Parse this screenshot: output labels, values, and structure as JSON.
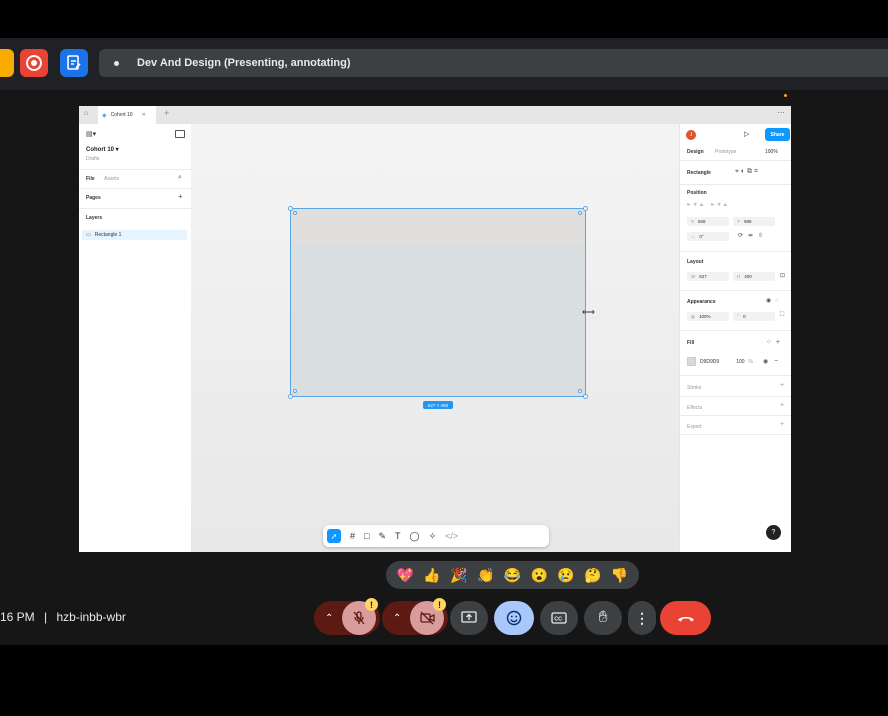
{
  "meet": {
    "presenting_title": "Dev And Design (Presenting, annotating)",
    "time": "16 PM",
    "separator": "|",
    "meeting_code": "hzb-inbb-wbr",
    "reactions": [
      "💖",
      "👍",
      "🎉",
      "👏",
      "😂",
      "😮",
      "😢",
      "🤔",
      "👎"
    ]
  },
  "figma": {
    "tab_title": "Cohort 10",
    "file_name": "Cohort 10",
    "file_location": "Drafts",
    "left_tabs": [
      "File",
      "Assets"
    ],
    "pages_label": "Pages",
    "layers_label": "Layers",
    "layer_name": "Rectangle 1",
    "avatar_initial": "J",
    "share_label": "Share",
    "design_tabs": [
      "Design",
      "Prototype"
    ],
    "zoom": "100%",
    "selection_type": "Rectangle",
    "position_label": "Position",
    "x_label": "X",
    "x_value": "658",
    "y_label": "Y",
    "y_value": "988",
    "rotation_value": "0°",
    "layout_label": "Layout",
    "w_label": "W",
    "w_value": "627",
    "h_label": "H",
    "h_value": "400",
    "appearance_label": "Appearance",
    "opacity_value": "100%",
    "radius_value": "0",
    "fill_label": "Fill",
    "fill_hex": "D9D9D9",
    "fill_opacity": "100",
    "fill_pct": "%",
    "stroke_label": "Stroke",
    "effects_label": "Effects",
    "export_label": "Export",
    "size_badge": "627 × 400",
    "help_label": "?"
  },
  "colors": {
    "fill": "#D9D9D9",
    "accent": "#0d99ff",
    "end_call": "#ea4335"
  }
}
